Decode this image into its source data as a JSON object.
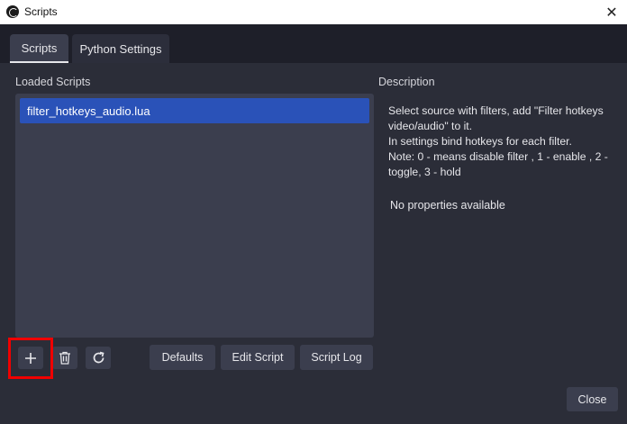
{
  "window": {
    "title": "Scripts",
    "app_icon": "obs-icon",
    "close_icon": "close-icon"
  },
  "tabs": [
    {
      "label": "Scripts",
      "active": true
    },
    {
      "label": "Python Settings",
      "active": false
    }
  ],
  "loaded_scripts": {
    "label": "Loaded Scripts",
    "items": [
      {
        "name": "filter_hotkeys_audio.lua",
        "selected": true
      }
    ]
  },
  "description": {
    "label": "Description",
    "lines": [
      "Select source with filters, add \"Filter hotkeys video/audio\" to it.",
      "In settings bind hotkeys for each filter.",
      "Note: 0 - means disable filter , 1 - enable , 2 - toggle, 3 - hold"
    ],
    "no_properties": "No properties available"
  },
  "toolbar": {
    "add_icon": "plus-icon",
    "remove_icon": "trash-icon",
    "reload_icon": "reload-icon",
    "defaults_label": "Defaults",
    "edit_label": "Edit Script",
    "log_label": "Script Log"
  },
  "footer": {
    "close_label": "Close"
  },
  "colors": {
    "selection": "#2a52b8",
    "highlight_box": "#f00000",
    "panel_bg": "#2b2d38",
    "list_bg": "#3b3e4e"
  }
}
